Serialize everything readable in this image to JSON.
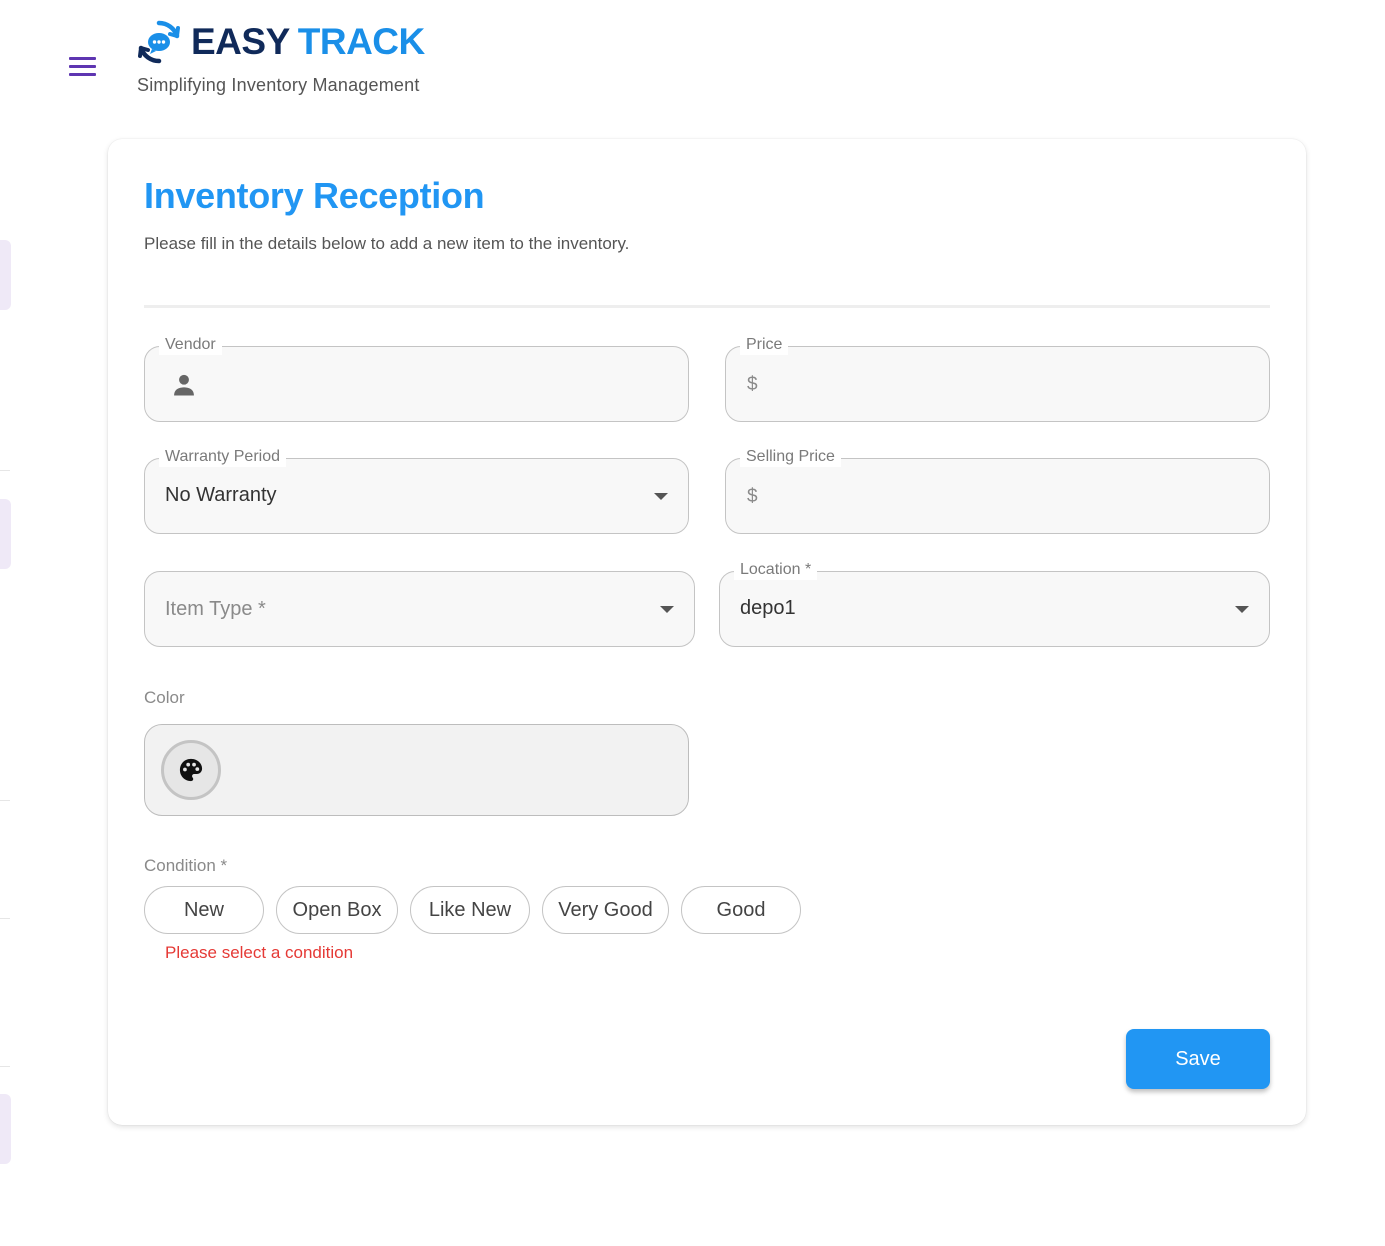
{
  "brand": {
    "name_part1": "EASY",
    "name_part2": "TRACK",
    "tagline": "Simplifying Inventory Management",
    "colors": {
      "navy": "#102a5a",
      "blue": "#1a8fe8"
    }
  },
  "nav": {
    "menu_icon": "hamburger-menu-icon"
  },
  "form": {
    "title": "Inventory Reception",
    "subtitle": "Please fill in the details below to add a new item to the inventory.",
    "vendor": {
      "label": "Vendor",
      "value": "",
      "icon": "person-icon"
    },
    "price": {
      "label": "Price",
      "prefix": "$",
      "value": ""
    },
    "warranty": {
      "label": "Warranty Period",
      "value": "No Warranty"
    },
    "selling_price": {
      "label": "Selling Price",
      "prefix": "$",
      "value": ""
    },
    "item_type": {
      "placeholder": "Item Type *",
      "value": ""
    },
    "location": {
      "label": "Location *",
      "value": "depo1"
    },
    "color": {
      "label": "Color",
      "icon": "palette-icon"
    },
    "condition": {
      "label": "Condition *",
      "options": [
        "New",
        "Open Box",
        "Like New",
        "Very Good",
        "Good"
      ],
      "error": "Please select a condition"
    },
    "save_label": "Save"
  },
  "theme": {
    "accent": "#2196f3",
    "error": "#e53935",
    "menu": "#5e35b1"
  }
}
